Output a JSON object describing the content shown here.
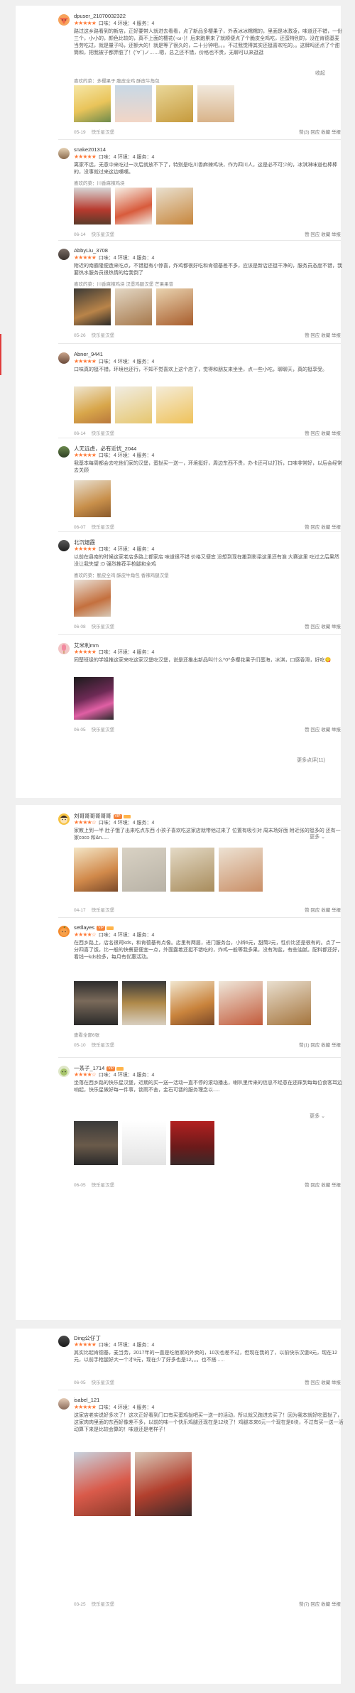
{
  "stars": "★★★★★",
  "stars4": "★★★★☆",
  "score_labels": {
    "taste": "口味：4",
    "env": "环境：4",
    "service": "服务：4"
  },
  "actions": {
    "like": "赞",
    "reply": "回应",
    "fav": "收藏",
    "report": "举报"
  },
  "shop_name": "快乐星汉堡",
  "more_label": "更多",
  "collapse_label": "收起",
  "show_more_link": "更多点评(11)",
  "colors": {
    "star": "#ff7733",
    "accent": "#e03c3c",
    "vip": "#f5833b"
  },
  "reviews": [
    {
      "user": "dpuser_21070032322",
      "score": "口味：4  环境：4  服务：4",
      "text": "路过这乡路看到的新店，正好要带人就进去看看，点了新品多樱果子，外表冰冰糯糯的，里面是冰激凌，味道还不错，一份三个，小小的，颜色比较的，真不上面的樱花(･ω･)！后来跑累来了就顺便点了个脆皮全鸡吃，还蛮特别的，没在肯德基麦当劳吃过，就是量子吗，还额大的！就是等了很久的，二十分钟吧。。。不过我觉得其实还挺喜欢吃的。。这牌吗还点了个甜筒和，把我被子都弄脏了！(′∀`)ノ……嗯，总之还不错，价格也不贵，无聊可以来逛逛",
      "tags": "喜欢的菜：多樱果子 脆皮全鸡 酥皮牛角包",
      "date": "05-19",
      "shop": "快乐星汉堡",
      "acts": "赞(3)  回应  收藏  举报"
    },
    {
      "user": "snake201314",
      "score": "口味：4  环境：4  服务：4",
      "text": "离家不远，无意中来吃过一次后就放不下了，特别是吃川香麻辣鸡块，作为四川人，这是必不可少的，冰淇淋味道也棒棒的，没事就过来这边嘴嘴。",
      "tags": "喜欢的菜：川香麻辣鸡块",
      "date": "06-14",
      "shop": "快乐星汉堡",
      "acts": "赞  回应  收藏  举报"
    },
    {
      "user": "AbbyLiu_3708",
      "score": "口味：4  环境：4  服务：4",
      "text": "附近的南霸隆便造来吃点，不错挺有小惊喜，炸鸡都很好吃和肯德基差不多，应该是新店还挺干净的，服务员态度不错，我要热水服务员很热情的给我倒了",
      "tags": "喜欢的菜：川香麻辣鸡块 汉堡鸡腿汉堡 芒果果昔",
      "date": "05-26",
      "shop": "快乐星汉堡",
      "acts": "赞  回应  收藏  举报"
    },
    {
      "user": "Abner_9441",
      "score": "口味：4  环境：4  服务：4",
      "text": "口味真的挺不错，环境也还行，不知不觉喜欢上这个店了，觉得和朋友来坐坐，点一些小吃，聊聊天，真的挺享受。",
      "tags": "",
      "date": "06-14",
      "shop": "快乐星汉堡",
      "acts": "赞  回应  收藏  举报"
    },
    {
      "user": "人无远虑，必有近忧_2044",
      "score": "口味：4  环境：4  服务：4",
      "text": "我基本每周都会去吃他们家的汉堡，蛋挞买一送一，环境挺好，周边东西不贵，办卡还可以打折，口味非常好，以后会经常去关顾",
      "tags": "",
      "date": "06-07",
      "shop": "快乐星汉堡",
      "acts": "赞  回应  收藏  举报"
    },
    {
      "user": "北沉烟霞",
      "score": "口味：4  环境：4  服务：4",
      "text": "以前在县南的时候这家老店多路上都家店 味道很不错 价格又便宜 没想到现在搬到影梁这里还有准 大赛这里 吃过之后果然没让我失望 :D 强烈推荐手枪腿和全鸡",
      "tags": "喜欢的菜：脆皮全鸡 酥皮牛角包 香辣鸡腿汉堡",
      "date": "06-08",
      "shop": "快乐星汉堡",
      "acts": "赞  回应  收藏  举报"
    },
    {
      "user": "艾米利mm",
      "score": "口味：4  环境：4  服务：4",
      "text": "同楚班级的学姐推这家来吃这家汉堡吃汉堡，说是还推出新品叫什么^0^多樱花果子们蛋海，冰淇，口感香滑，好吃😋",
      "tags": "",
      "date": "06-05",
      "shop": "快乐星汉堡",
      "acts": "赞  回应  收藏  举报"
    },
    {
      "user": "刘哥哥哥哥哥哥",
      "vip": "VIP",
      "score": "口味：4  环境：4  服务：4",
      "text": "家教上到一半 肚子饿了出来吃点东西 小孩子喜欢吃这家店就带他过来了 位置有吸引对 周末场好面 附近张的挺多的 还有一家coco 和&n.....",
      "tags": "",
      "date": "04-17",
      "shop": "快乐星汉堡",
      "acts": "赞  回应  收藏  举报"
    },
    {
      "user": "setllayes",
      "vip": "VIP",
      "score": "口味：4  环境：4  服务：4",
      "text": "在西乡路上，店名很司kds，和肯德基有点像。店里有两层，进门服务台，小辫6元，甜筒2元，性价比还是很有的。点了一分四喜了饭，比一般的快餐更便宜一点，外面露着还挺不错吃的，炸鸡一般等我多果，没有淘盆，有些油腻。配料都还好，看钱一kds较多，每月有优惠活动。",
      "tags": "",
      "extra": "查看全部6张",
      "date": "05-10",
      "shop": "快乐星汉堡",
      "acts": "赞(1)  回应  收藏  举报"
    },
    {
      "user": "一茶子_1714",
      "vip": "VIP",
      "score": "口味：4  环境：4  服务：4",
      "text": "坐落在西乡路的快乐星汉堡，近期的买一送一活动一直不停的滚动播出，喇叭里传来的信息不经意在还踩到每每位食客耳边响起，快乐星做好每一件事，锁雨不舍，金石可镂的服务理念以.....",
      "tags": "",
      "date": "06-05",
      "shop": "快乐星汉堡",
      "acts": "赞  回应  收藏  举报"
    },
    {
      "user": "Ding公仔丁",
      "score": "口味：4  环境：4  服务：4",
      "text": "其实比起肯德基，麦当劳，2017年的一直是吃他家的外卖的，10次也差不过，但现在我的了，以前快乐汉堡8元，现在12元，以前手枪腿好大一个才9元，现在少了好多也是12。。。也不搭......",
      "tags": "",
      "date": "06-05",
      "shop": "快乐星汉堡",
      "acts": "赞  回应  收藏  举报"
    },
    {
      "user": "isabel_121",
      "score": "口味：4  环境：4  服务：4",
      "text": "这家店老实说好多次了！这次正好看到门口有买蛋鸡挞吧买一送一的活动，所以就又跑进去买了！因为我本就好吃蛋挞了，这家肉肉里面的东西好像差不多，以前的味一个快乐鸡腿还现在是12块了！鸡腿本来6元一个现在是8块，不过有买一送一活动算下来是比较会算的！味道还是老样子！",
      "tags": "",
      "date": "03-25",
      "shop": "快乐星汉堡",
      "acts": "赞(7)  回应  收藏  举报"
    }
  ]
}
